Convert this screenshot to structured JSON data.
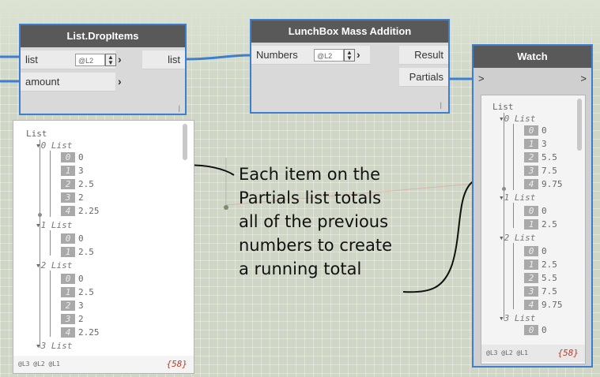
{
  "drop_node": {
    "title": "List.DropItems",
    "inputs": [
      {
        "label": "list",
        "lacing": "@L2"
      },
      {
        "label": "amount"
      }
    ],
    "output": "list"
  },
  "mass_node": {
    "title": "LunchBox Mass Addition",
    "input": {
      "label": "Numbers",
      "lacing": "@L2"
    },
    "outputs": [
      "Result",
      "Partials"
    ]
  },
  "watch_node": {
    "title": "Watch",
    "in_port": ">",
    "out_port": ">",
    "footer_levels": "@L3 @L2 @L1",
    "count": "{58}",
    "tree": {
      "root": "List",
      "groups": [
        {
          "label": "0 List",
          "items": [
            [
              "0",
              "0"
            ],
            [
              "1",
              "3"
            ],
            [
              "2",
              "5.5"
            ],
            [
              "3",
              "7.5"
            ],
            [
              "4",
              "9.75"
            ]
          ]
        },
        {
          "label": "1 List",
          "items": [
            [
              "0",
              "0"
            ],
            [
              "1",
              "2.5"
            ]
          ]
        },
        {
          "label": "2 List",
          "items": [
            [
              "0",
              "0"
            ],
            [
              "1",
              "2.5"
            ],
            [
              "2",
              "5.5"
            ],
            [
              "3",
              "7.5"
            ],
            [
              "4",
              "9.75"
            ]
          ]
        },
        {
          "label": "3 List",
          "items": [
            [
              "0",
              "0"
            ]
          ]
        }
      ]
    }
  },
  "drop_preview": {
    "footer_levels": "@L3 @L2 @L1",
    "count": "{58}",
    "tree": {
      "root": "List",
      "groups": [
        {
          "label": "0 List",
          "items": [
            [
              "0",
              "0"
            ],
            [
              "1",
              "3"
            ],
            [
              "2",
              "2.5"
            ],
            [
              "3",
              "2"
            ],
            [
              "4",
              "2.25"
            ]
          ]
        },
        {
          "label": "1 List",
          "items": [
            [
              "0",
              "0"
            ],
            [
              "1",
              "2.5"
            ]
          ]
        },
        {
          "label": "2 List",
          "items": [
            [
              "0",
              "0"
            ],
            [
              "1",
              "2.5"
            ],
            [
              "2",
              "3"
            ],
            [
              "3",
              "2"
            ],
            [
              "4",
              "2.25"
            ]
          ]
        },
        {
          "label": "3 List",
          "items": []
        }
      ]
    }
  },
  "callout": {
    "lines": [
      "Each item on the",
      "Partials list totals",
      "all of the previous",
      "numbers to create",
      "a running total"
    ]
  }
}
